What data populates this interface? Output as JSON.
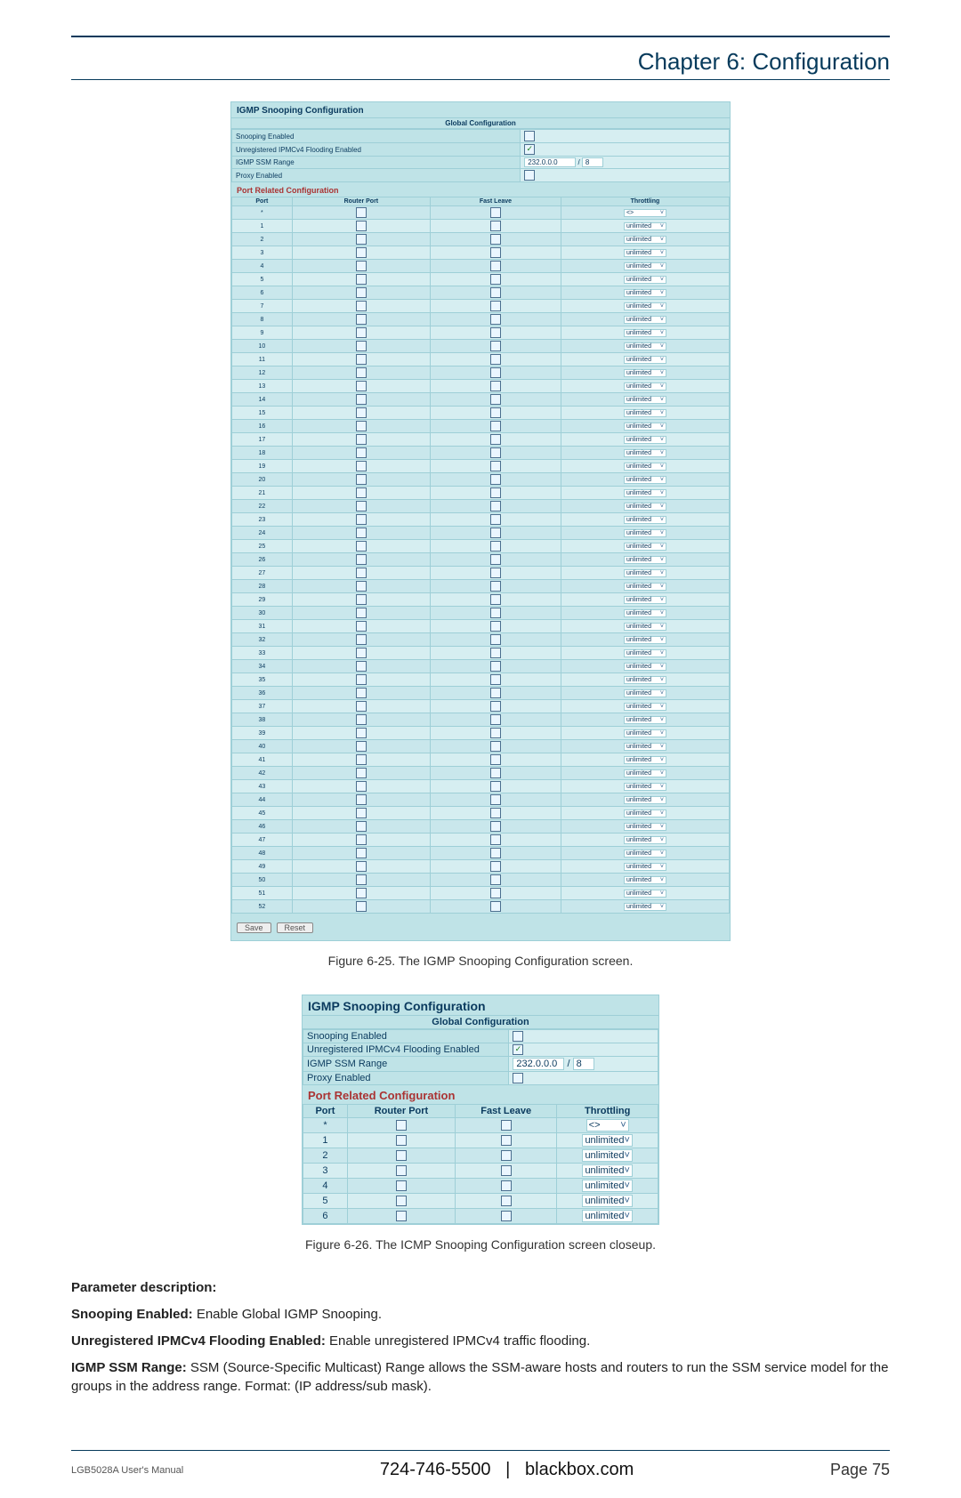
{
  "chapter": "Chapter 6: Configuration",
  "figure1": {
    "title": "IGMP Snooping Configuration",
    "global_header": "Global Configuration",
    "rows": [
      {
        "label": "Snooping Enabled",
        "checked": false
      },
      {
        "label": "Unregistered IPMCv4 Flooding Enabled",
        "checked": true
      },
      {
        "label": "IGMP SSM Range",
        "ip_value": "232.0.0.0",
        "mask_value": "8"
      },
      {
        "label": "Proxy Enabled",
        "checked": false
      }
    ],
    "port_header": "Port Related Configuration",
    "columns": [
      "Port",
      "Router Port",
      "Fast Leave",
      "Throttling"
    ],
    "star_row_throttling": "<>",
    "port_count": 52,
    "throttling_default": "unlimited",
    "save_btn": "Save",
    "reset_btn": "Reset",
    "caption": "Figure 6-25. The IGMP Snooping Configuration screen."
  },
  "figure2": {
    "title": "IGMP Snooping Configuration",
    "global_header": "Global Configuration",
    "rows": [
      {
        "label": "Snooping Enabled",
        "checked": false
      },
      {
        "label": "Unregistered IPMCv4 Flooding Enabled",
        "checked": true
      },
      {
        "label": "IGMP SSM Range",
        "ip_value": "232.0.0.0",
        "mask_value": "8"
      },
      {
        "label": "Proxy Enabled",
        "checked": false
      }
    ],
    "port_header": "Port Related Configuration",
    "columns": [
      "Port",
      "Router Port",
      "Fast Leave",
      "Throttling"
    ],
    "star_row_throttling": "<>",
    "port_count": 6,
    "throttling_default": "unlimited",
    "caption": "Figure 6-26. The ICMP Snooping Configuration screen closeup."
  },
  "body": {
    "param_header": "Parameter description:",
    "p1_bold": "Snooping Enabled:",
    "p1_rest": " Enable Global IGMP Snooping.",
    "p2_bold": "Unregistered IPMCv4 Flooding Enabled:",
    "p2_rest": " Enable unregistered IPMCv4 traffic flooding.",
    "p3_bold": "IGMP SSM Range:",
    "p3_rest": " SSM (Source-Specific Multicast) Range allows the SSM-aware hosts and routers to run the SSM service model for the groups in the address range. Format: (IP address/sub mask)."
  },
  "footer": {
    "manual": "LGB5028A User's Manual",
    "phone": "724-746-5500",
    "site": "blackbox.com",
    "page_label": "Page 75"
  }
}
